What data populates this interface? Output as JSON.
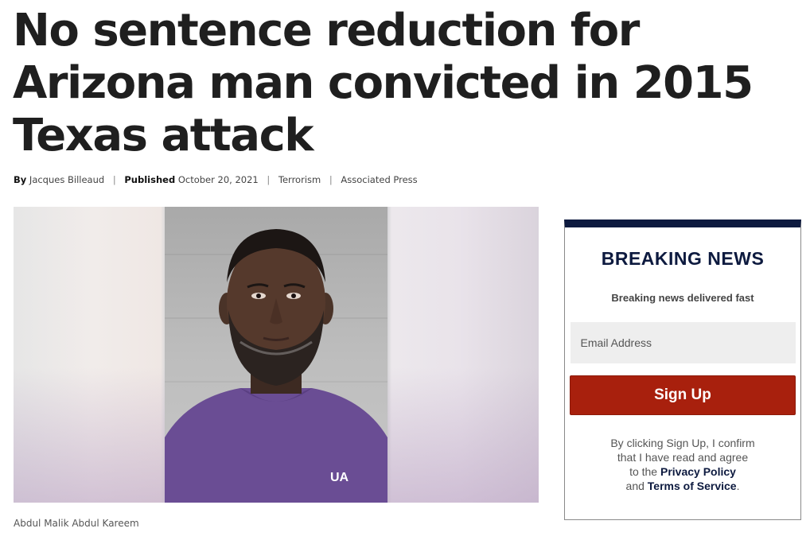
{
  "article": {
    "headline": "No sentence reduction for Arizona man convicted in 2015 Texas attack",
    "byline": {
      "by_label": "By",
      "author": "Jacques Billeaud",
      "published_label": "Published",
      "date": "October 20, 2021",
      "category": "Terrorism",
      "source": "Associated Press",
      "separator": "|"
    },
    "photo_caption": "Abdul Malik Abdul Kareem"
  },
  "signup": {
    "title": "BREAKING NEWS",
    "subtitle": "Breaking news delivered fast",
    "email_placeholder": "Email Address",
    "button_label": "Sign Up",
    "legal_line1": "By clicking Sign Up, I confirm",
    "legal_line2": "that I have read and agree",
    "legal_line3_prefix": "to the",
    "privacy_link": "Privacy Policy",
    "legal_line4_prefix": "and",
    "terms_link": "Terms of Service",
    "legal_end": ".",
    "colors": {
      "accent": "#0d1a3f",
      "button": "#a8200d"
    }
  }
}
